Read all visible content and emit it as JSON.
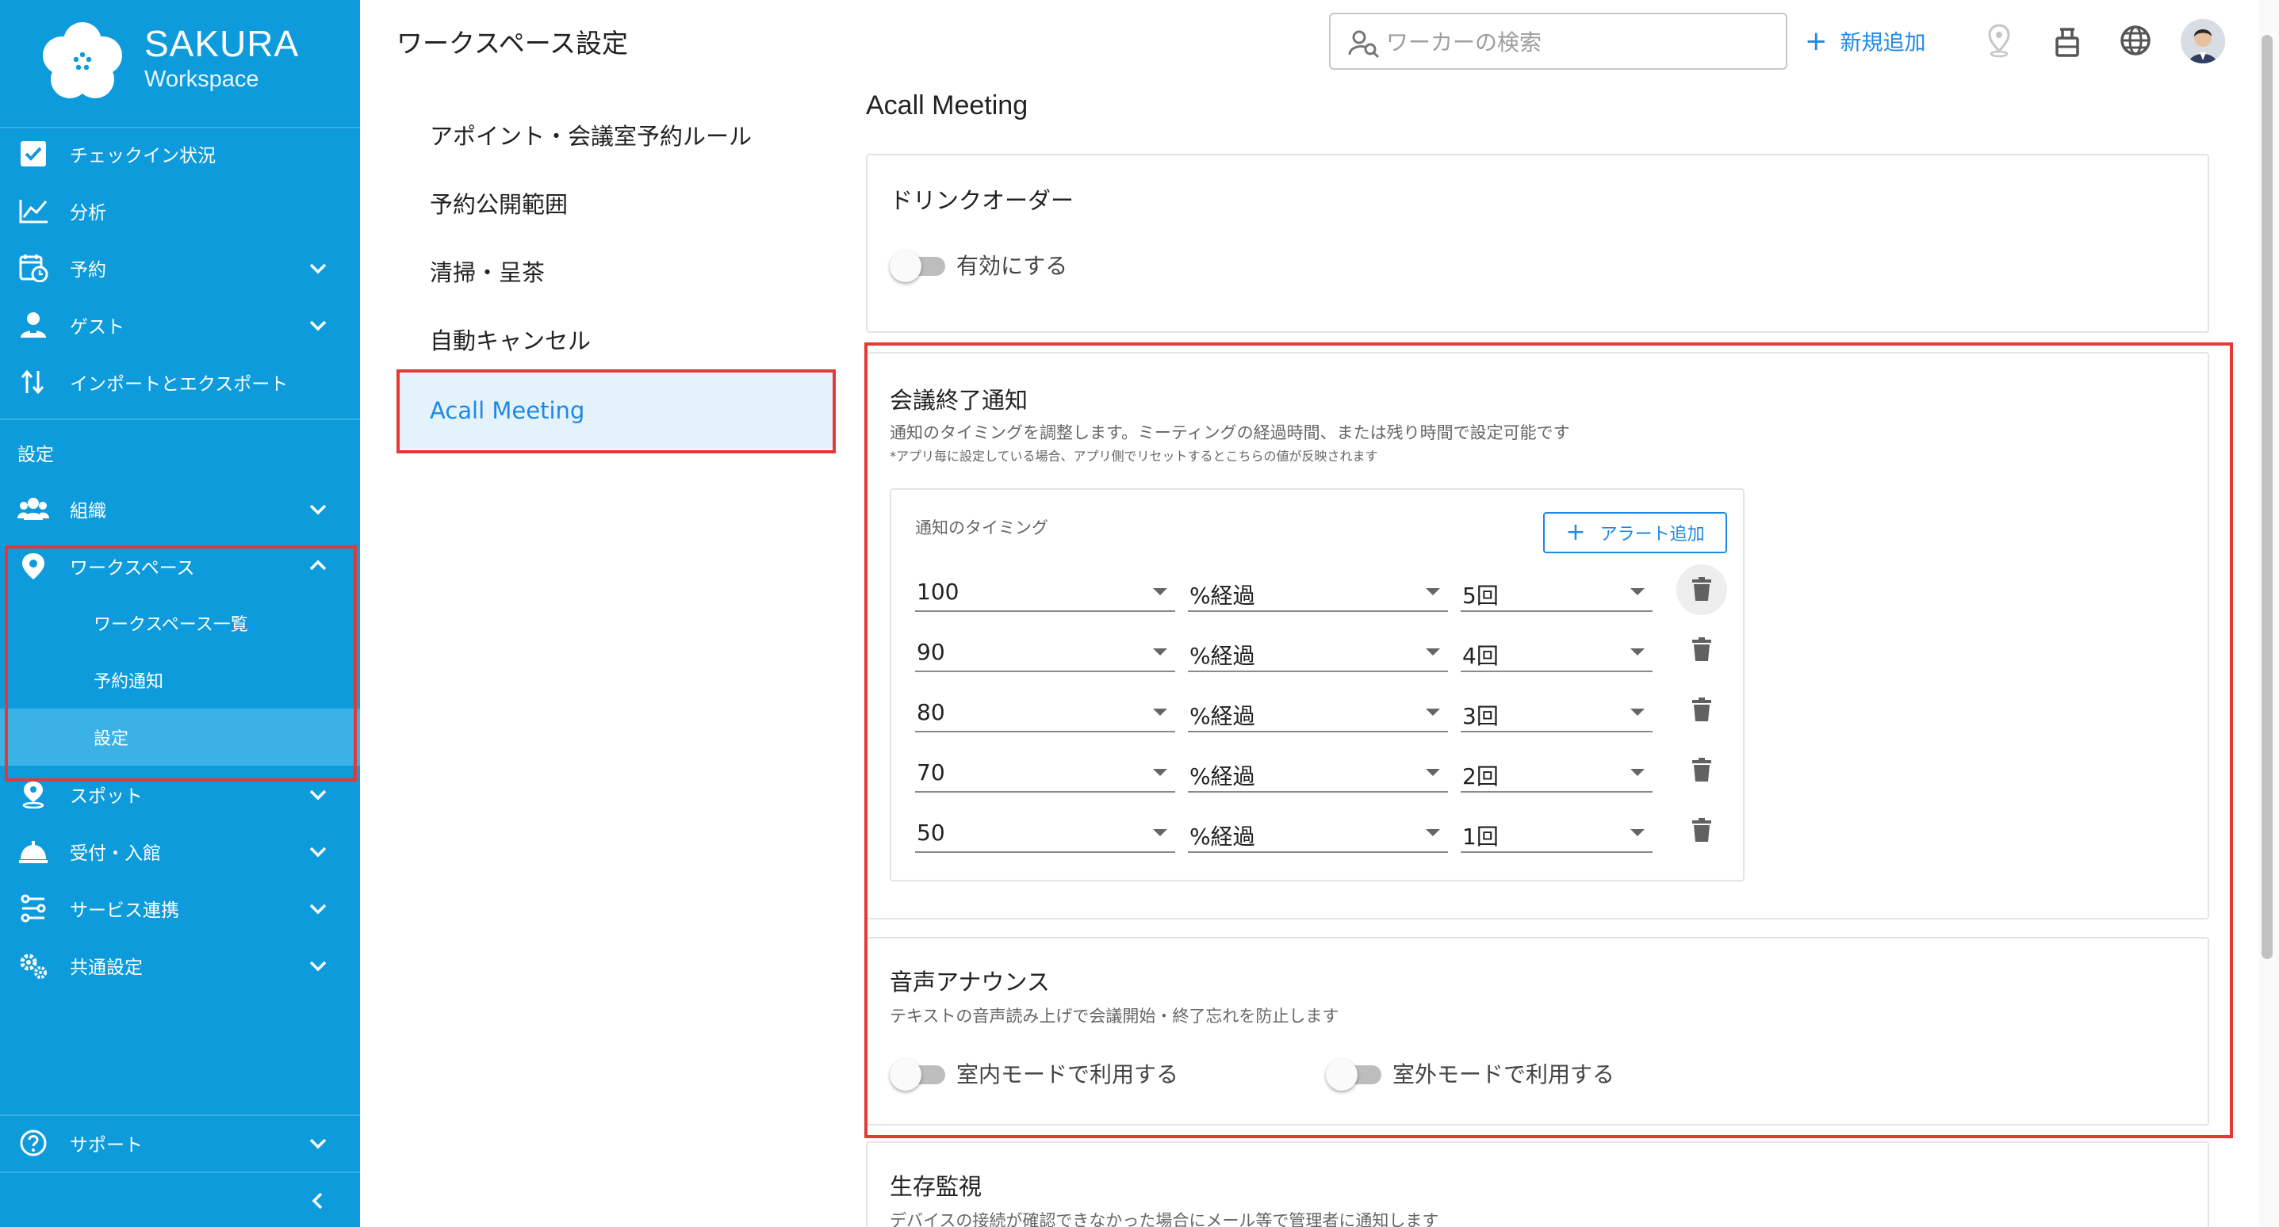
{
  "brand": {
    "name": "SAKURA",
    "sub": "Workspace"
  },
  "sidebar": {
    "items": [
      {
        "label": "チェックイン状況"
      },
      {
        "label": "分析"
      },
      {
        "label": "予約"
      },
      {
        "label": "ゲスト"
      },
      {
        "label": "インポートとエクスポート"
      }
    ],
    "section_label": "設定",
    "settings_items": [
      {
        "label": "組織"
      },
      {
        "label": "ワークスペース"
      }
    ],
    "workspace_sub": [
      {
        "label": "ワークスペース一覧"
      },
      {
        "label": "予約通知"
      },
      {
        "label": "設定"
      }
    ],
    "more_items": [
      {
        "label": "スポット"
      },
      {
        "label": "受付・入館"
      },
      {
        "label": "サービス連携"
      },
      {
        "label": "共通設定"
      }
    ],
    "support_label": "サポート"
  },
  "header": {
    "title": "ワークスペース設定",
    "search_placeholder": "ワーカーの検索",
    "add_new": "新規追加"
  },
  "settings_nav": [
    {
      "label": "アポイント・会議室予約ルール"
    },
    {
      "label": "予約公開範囲"
    },
    {
      "label": "清掃・呈茶"
    },
    {
      "label": "自動キャンセル"
    },
    {
      "label": "Acall Meeting"
    }
  ],
  "content": {
    "title": "Acall Meeting",
    "drink": {
      "title": "ドリンクオーダー",
      "toggle_label": "有効にする",
      "enabled": false
    },
    "meeting_end": {
      "title": "会議終了通知",
      "desc": "通知のタイミングを調整します。ミーティングの経過時間、または残り時間で設定可能です",
      "note": "*アプリ毎に設定している場合、アプリ側でリセットするとこちらの値が反映されます",
      "timing_label": "通知のタイミング",
      "add_alert": "アラート追加",
      "rows": [
        {
          "value": "100",
          "unit": "%経過",
          "count": "5回"
        },
        {
          "value": "90",
          "unit": "%経過",
          "count": "4回"
        },
        {
          "value": "80",
          "unit": "%経過",
          "count": "3回"
        },
        {
          "value": "70",
          "unit": "%経過",
          "count": "2回"
        },
        {
          "value": "50",
          "unit": "%経過",
          "count": "1回"
        }
      ]
    },
    "voice": {
      "title": "音声アナウンス",
      "desc": "テキストの音声読み上げで会議開始・終了忘れを防止します",
      "indoor_label": "室内モードで利用する",
      "outdoor_label": "室外モードで利用する",
      "indoor": false,
      "outdoor": false
    },
    "alive": {
      "title": "生存監視",
      "desc": "デバイスの接続が確認できなかった場合にメール等で管理者に通知します"
    }
  },
  "colors": {
    "sidebar": "#0d9bdb",
    "accent": "#1e88e5",
    "highlight": "#e53935"
  }
}
